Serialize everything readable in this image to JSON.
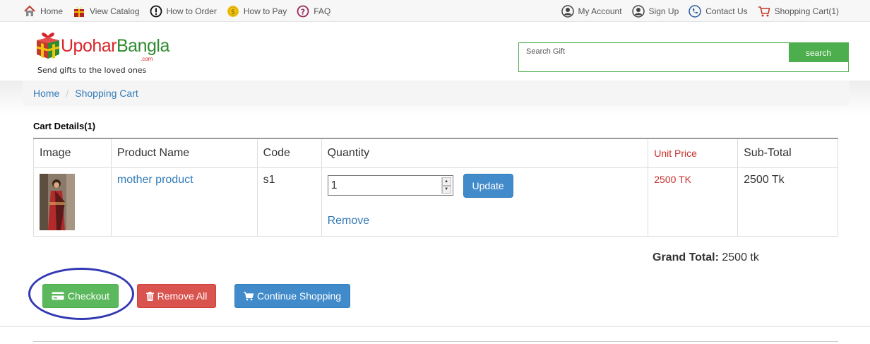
{
  "topnav": {
    "left": [
      {
        "label": "Home",
        "icon": "home-icon"
      },
      {
        "label": "View Catalog",
        "icon": "gift-icon"
      },
      {
        "label": "How to Order",
        "icon": "info-icon"
      },
      {
        "label": "How to Pay",
        "icon": "coin-icon"
      },
      {
        "label": "FAQ",
        "icon": "question-icon"
      }
    ],
    "right": [
      {
        "label": "My Account",
        "icon": "user-icon"
      },
      {
        "label": "Sign Up",
        "icon": "user-icon"
      },
      {
        "label": "Contact Us",
        "icon": "phone-icon"
      },
      {
        "label": "Shopping Cart(1)",
        "icon": "cart-icon"
      }
    ]
  },
  "logo": {
    "name_part1": "Upohar",
    "name_part2": "Bangla",
    "domain": ".com",
    "tagline": "Send gifts to the loved ones"
  },
  "search": {
    "placeholder": "Search Gift",
    "button_label": "search"
  },
  "breadcrumb": {
    "home": "Home",
    "separator": "/",
    "current": "Shopping Cart"
  },
  "cart": {
    "title": "Cart Details(1)",
    "headers": {
      "image": "Image",
      "product_name": "Product Name",
      "code": "Code",
      "quantity": "Quantity",
      "unit_price": "Unit Price",
      "sub_total": "Sub-Total"
    },
    "items": [
      {
        "product_name": "mother product",
        "code": "s1",
        "quantity": "1",
        "update_label": "Update",
        "remove_label": "Remove",
        "unit_price": "2500 TK",
        "sub_total": "2500 Tk"
      }
    ],
    "grand_total_label": "Grand Total:",
    "grand_total_value": "2500 tk"
  },
  "actions": {
    "checkout": "Checkout",
    "remove_all": "Remove All",
    "continue_shopping": "Continue Shopping"
  },
  "colors": {
    "primary_blue": "#428bca",
    "success_green": "#5cb85c",
    "danger_red": "#d9534f",
    "price_red": "#c9302c",
    "annotation_circle": "#3339b3"
  }
}
